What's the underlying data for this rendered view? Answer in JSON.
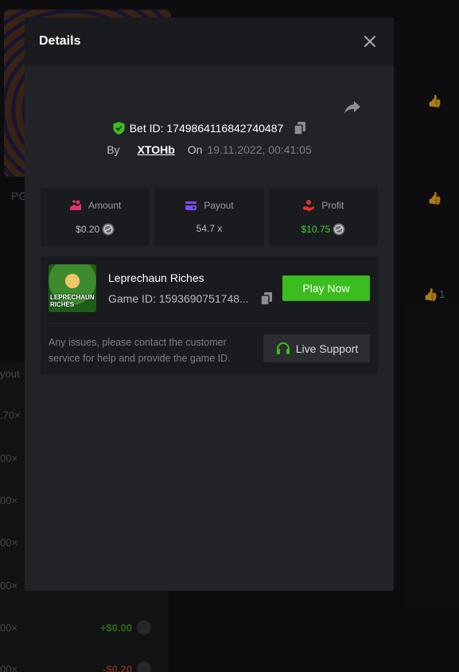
{
  "modal": {
    "title": "Details",
    "bet_id_label": "Bet ID: 1749864116842740487",
    "by_label": "By",
    "username": "XTOHb",
    "on_label": "On",
    "date": "19.11.2022, 00:41:05"
  },
  "stats": {
    "amount": {
      "label": "Amount",
      "value": "$0.20"
    },
    "payout": {
      "label": "Payout",
      "value": "54.7 x"
    },
    "profit": {
      "label": "Profit",
      "value": "$10.75"
    }
  },
  "game": {
    "name": "Leprechaun Riches",
    "thumb_text": "LEPRECHAUN RICHES",
    "game_id": "Game ID: 1593690751748...",
    "play_button": "Play Now",
    "help_text": "Any issues, please contact the customer service for help and provide the game ID.",
    "support_button": "Live Support"
  },
  "background": {
    "thumb_caption": "PG",
    "column_header": "yout",
    "rows": [
      {
        "multiplier": ".70×",
        "value": ""
      },
      {
        "multiplier": "00×",
        "value": ""
      },
      {
        "multiplier": "00×",
        "value": ""
      },
      {
        "multiplier": "00×",
        "value": ""
      },
      {
        "multiplier": "00×",
        "value": ""
      },
      {
        "multiplier": "00×",
        "value": "+$0.00"
      },
      {
        "multiplier": "00×",
        "value": "-$0.20"
      }
    ],
    "like_count": "1"
  },
  "colors": {
    "accent_green": "#3bbd1f",
    "profit_green": "#3fd128",
    "amount_pink": "#e0336a",
    "payout_purple": "#7a4df0",
    "profit_red": "#e0342a",
    "modal_bg": "#222327"
  },
  "icons": {
    "close": "close-icon",
    "share": "share-icon",
    "shield": "shield-check-icon",
    "copy": "copy-icon",
    "amount": "coins-icon",
    "payout": "wallet-icon",
    "profit": "hand-coin-icon",
    "coin": "coin-icon",
    "support": "headset-icon"
  }
}
